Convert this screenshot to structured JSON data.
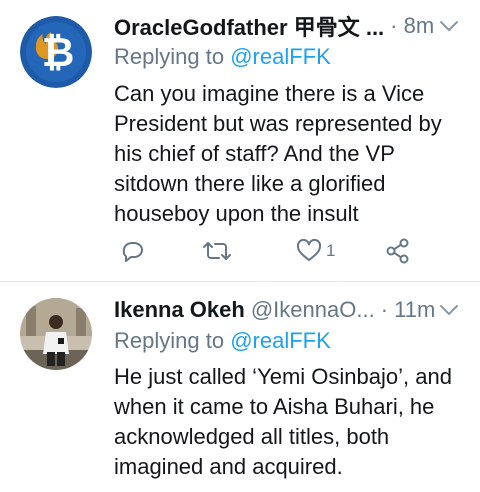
{
  "tweets": [
    {
      "display_name": "OracleGodfather 甲骨文 ...",
      "handle": "",
      "meta": "· 8m",
      "reply_prefix": "Replying to ",
      "reply_mention": "@realFFK",
      "text": "Can you imagine there is a Vice President but was represented by his chief of staff? And the VP sitdown there like a glorified houseboy upon the insult",
      "like_count": "1",
      "avatar_icon": "bitcoin-logo-icon",
      "colors": {
        "avatar_bg": "#1e5aa8"
      }
    },
    {
      "display_name": "Ikenna Okeh",
      "handle": "@IkennaO...",
      "meta": "· 11m",
      "reply_prefix": "Replying to ",
      "reply_mention": "@realFFK",
      "text": "He just called ‘Yemi Osinbajo’, and when it came to Aisha Buhari, he acknowledged all titles, both imagined and acquired."
    }
  ],
  "colors": {
    "secondary_text": "#657786",
    "link": "#1da1f2",
    "divider": "#e1e8ed"
  }
}
